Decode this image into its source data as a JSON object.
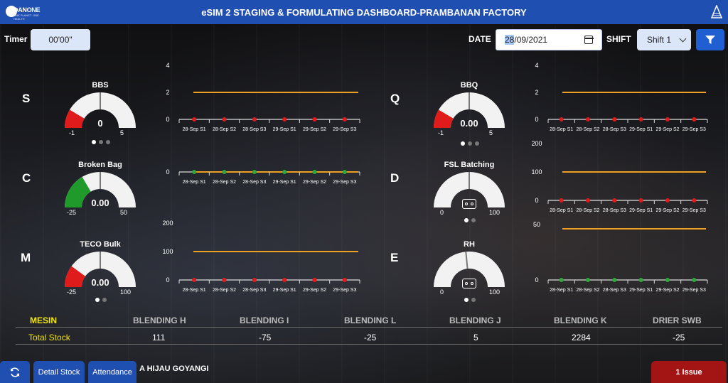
{
  "header": {
    "title": "eSIM 2 STAGING & FORMULATING DASHBOARD-PRAMBANAN FACTORY",
    "logo_text": "DANONE",
    "logo_sub": "ONE PLANET. ONE HEALTH"
  },
  "controls": {
    "timer_label": "Timer",
    "timer_value": "00'00\"",
    "date_label": "DATE",
    "date_day": "28",
    "date_rest": "/09/2021",
    "shift_label": "SHIFT",
    "shift_value": "Shift 1"
  },
  "sections": [
    {
      "letter": "S",
      "gauge": {
        "name": "BBS",
        "value": "0",
        "min": "-1",
        "max": "5",
        "fill": 0.17,
        "color": "#e01b1b"
      }
    },
    {
      "letter": "C",
      "gauge": {
        "name": "Broken Bag",
        "value": "0.00",
        "min": "-25",
        "max": "50",
        "fill": 0.33,
        "color": "#1f9a2b"
      }
    },
    {
      "letter": "M",
      "gauge": {
        "name": "TECO Bulk",
        "value": "0.00",
        "min": "-25",
        "max": "100",
        "fill": 0.2,
        "color": "#e01b1b"
      }
    },
    {
      "letter": "Q",
      "gauge": {
        "name": "BBQ",
        "value": "0.00",
        "min": "-1",
        "max": "5",
        "fill": 0.17,
        "color": "#e01b1b"
      }
    },
    {
      "letter": "D",
      "gauge": {
        "name": "FSL Batching",
        "value": "",
        "min": "0",
        "max": "100",
        "fill": 0,
        "color": "#e01b1b"
      }
    },
    {
      "letter": "E",
      "gauge": {
        "name": "RH",
        "value": "",
        "min": "0",
        "max": "100",
        "fill": 0,
        "color": "#e01b1b"
      }
    }
  ],
  "chart_data": [
    {
      "type": "line",
      "categories": [
        "28-Sep S1",
        "28-Sep S2",
        "28-Sep S3",
        "29-Sep S1",
        "29-Sep S2",
        "29-Sep S3"
      ],
      "yticks": [
        0,
        2,
        4
      ],
      "ylim": [
        0,
        4
      ],
      "target": 2,
      "values": [
        0,
        0,
        0,
        0,
        0,
        0
      ],
      "point_color": "#e01b1b"
    },
    {
      "type": "line",
      "categories": [
        "28-Sep S1",
        "28-Sep S2",
        "28-Sep S3",
        "29-Sep S1",
        "29-Sep S2",
        "29-Sep S3"
      ],
      "yticks": [
        0
      ],
      "ylim": [
        0,
        0
      ],
      "target": 0,
      "values": [
        0,
        0,
        0,
        0,
        0,
        0
      ],
      "point_color": "#2fa83a"
    },
    {
      "type": "line",
      "categories": [
        "28-Sep S1",
        "28-Sep S2",
        "28-Sep S3",
        "29-Sep S1",
        "29-Sep S2",
        "29-Sep S3"
      ],
      "yticks": [
        0,
        100,
        200
      ],
      "ylim": [
        0,
        200
      ],
      "target": 100,
      "values": [
        0,
        0,
        0,
        0,
        0,
        0
      ],
      "point_color": "#e01b1b"
    },
    {
      "type": "line",
      "categories": [
        "28-Sep S1",
        "28-Sep S2",
        "28-Sep S3",
        "29-Sep S1",
        "29-Sep S2",
        "29-Sep S3"
      ],
      "yticks": [
        0,
        2,
        4
      ],
      "ylim": [
        0,
        4
      ],
      "target": 2,
      "values": [
        0,
        0,
        0,
        0,
        0,
        0
      ],
      "point_color": "#e01b1b"
    },
    {
      "type": "line",
      "categories": [
        "28-Sep S1",
        "28-Sep S2",
        "28-Sep S3",
        "29-Sep S1",
        "29-Sep S2",
        "29-Sep S3"
      ],
      "yticks": [
        0,
        100,
        200
      ],
      "ylim": [
        0,
        200
      ],
      "target": 100,
      "values": [
        0,
        0,
        0,
        0,
        0,
        0
      ],
      "point_color": "#e01b1b"
    },
    {
      "type": "line",
      "categories": [
        "28-Sep S1",
        "28-Sep S2",
        "28-Sep S3",
        "29-Sep S1",
        "29-Sep S2",
        "29-Sep S3"
      ],
      "yticks": [
        0,
        50
      ],
      "ylim": [
        0,
        50
      ],
      "target": 50,
      "values": [
        0,
        0,
        0,
        0,
        0,
        0
      ],
      "point_color": "#2fa83a"
    }
  ],
  "table": {
    "label_header": "MESIN",
    "row_label": "Total Stock",
    "machines": [
      "BLENDING H",
      "BLENDING I",
      "BLENDING L",
      "BLENDING J",
      "BLENDING K",
      "DRIER SWB"
    ],
    "values": [
      "111",
      "-75",
      "-25",
      "5",
      "2284",
      "-25"
    ]
  },
  "footer": {
    "marquee": "A HIJAU GOYANGI",
    "detail_stock": "Detail Stock",
    "attendance": "Attendance",
    "issue": "1 Issue"
  }
}
